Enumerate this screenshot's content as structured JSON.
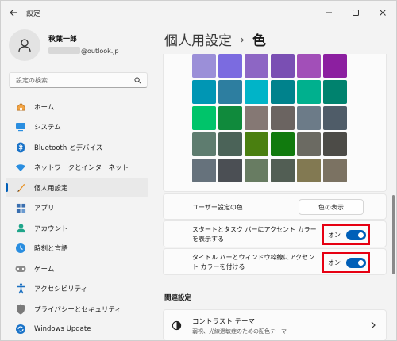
{
  "app": {
    "title": "設定"
  },
  "user": {
    "name": "秋葉一郎",
    "email_suffix": "@outlook.jp"
  },
  "search": {
    "placeholder": "設定の検索"
  },
  "sidebar": {
    "items": [
      {
        "label": "ホーム",
        "icon": "home-icon"
      },
      {
        "label": "システム",
        "icon": "system-icon"
      },
      {
        "label": "Bluetooth とデバイス",
        "icon": "bluetooth-icon"
      },
      {
        "label": "ネットワークとインターネット",
        "icon": "wifi-icon"
      },
      {
        "label": "個人用設定",
        "icon": "brush-icon",
        "active": true
      },
      {
        "label": "アプリ",
        "icon": "apps-icon"
      },
      {
        "label": "アカウント",
        "icon": "account-icon"
      },
      {
        "label": "時刻と言語",
        "icon": "clock-language-icon"
      },
      {
        "label": "ゲーム",
        "icon": "game-controller-icon"
      },
      {
        "label": "アクセシビリティ",
        "icon": "accessibility-icon"
      },
      {
        "label": "プライバシーとセキュリティ",
        "icon": "shield-icon"
      },
      {
        "label": "Windows Update",
        "icon": "update-icon"
      }
    ]
  },
  "breadcrumb": {
    "parent": "個人用設定",
    "separator": "›",
    "current": "色"
  },
  "swatches": [
    "#9b8fd8",
    "#7b6be0",
    "#8d66c4",
    "#7a4fb3",
    "#a24fb8",
    "#8c1fa0",
    "#0096b4",
    "#2d7ea0",
    "#00b4c8",
    "#00828c",
    "#00b08e",
    "#00826e",
    "#00c46a",
    "#108a3c",
    "#857874",
    "#6b6461",
    "#6c7b88",
    "#4f5c68",
    "#5e7c6f",
    "#4b6358",
    "#4a7f10",
    "#117a0e",
    "#6b6a62",
    "#4c4b47",
    "#66727c",
    "#4b4f54",
    "#687c62",
    "#525e54",
    "#827952",
    "#7b7262"
  ],
  "user_color": {
    "label": "ユーザー設定の色",
    "button": "色の表示"
  },
  "start_taskbar": {
    "label": "スタートとタスク バーにアクセント カラーを表示する",
    "state": "オン"
  },
  "title_bars": {
    "label": "タイトル バーとウィンドウ枠線にアクセント カラーを付ける",
    "state": "オン"
  },
  "related": {
    "heading": "関連設定",
    "contrast_title": "コントラスト テーマ",
    "contrast_subtitle": "弱視、光線過敏症のための配色テーマ"
  },
  "colors": {
    "accent": "#005fb8",
    "highlight_border": "#e60012"
  }
}
